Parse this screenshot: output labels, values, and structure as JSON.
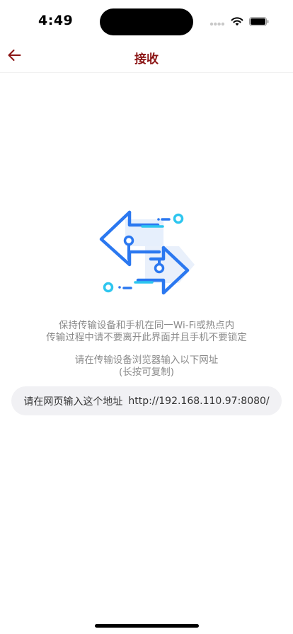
{
  "status_bar": {
    "time": "4:49",
    "icons": [
      "signal-dots-icon",
      "wifi-icon",
      "battery-icon"
    ]
  },
  "nav": {
    "title": "接收",
    "back_icon": "arrow-left-icon",
    "accent_color": "#8b1414"
  },
  "illustration": {
    "icon": "transfer-arrows-icon",
    "colors": {
      "primary": "#2b78f0",
      "accent": "#2ec6ef",
      "shadow": "#e6effc"
    }
  },
  "hints": {
    "line1": "保持传输设备和手机在同一Wi-Fi或热点内",
    "line2": "传输过程中请不要离开此界面并且手机不要锁定",
    "line3": "请在传输设备浏览器输入以下网址",
    "line4": "(长按可复制)"
  },
  "url_box": {
    "label": "请在网页输入这个地址",
    "url": "http://192.168.110.97:8080/"
  }
}
